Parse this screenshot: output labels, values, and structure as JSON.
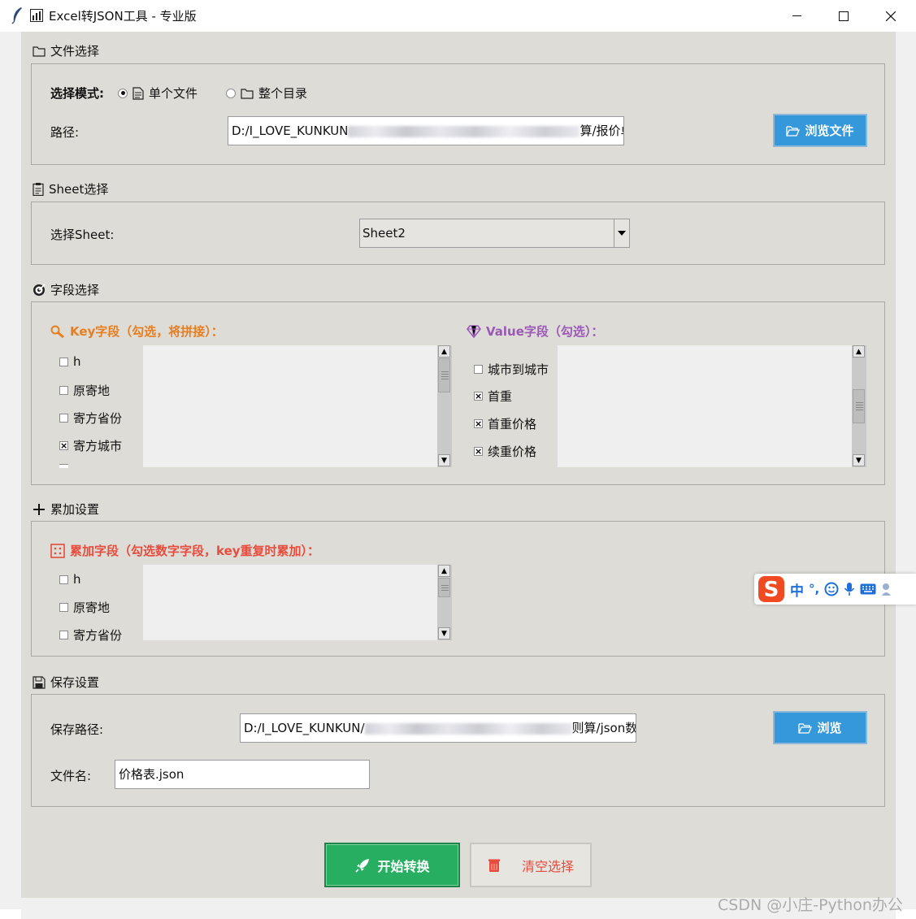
{
  "window": {
    "title": "Excel转JSON工具 - 专业版",
    "controls": {
      "minimize": "—",
      "maximize": "☐",
      "close": "✕"
    }
  },
  "file_section": {
    "title": "文件选择",
    "mode_label": "选择模式:",
    "mode_options": [
      {
        "label": "单个文件",
        "selected": true
      },
      {
        "label": "整个目录",
        "selected": false
      }
    ],
    "path_label": "路径:",
    "path_prefix": "D:/I_LOVE_KUNKUN",
    "path_suffix": "算/报价单",
    "browse_label": "浏览文件"
  },
  "sheet_section": {
    "title": "Sheet选择",
    "label": "选择Sheet:",
    "selected": "Sheet2"
  },
  "field_section": {
    "title": "字段选择",
    "key_title": "Key字段（勾选，将拼接）：",
    "value_title": "Value字段（勾选）：",
    "key_fields": [
      {
        "label": "h",
        "checked": false
      },
      {
        "label": "原寄地",
        "checked": false
      },
      {
        "label": "寄方省份",
        "checked": false
      },
      {
        "label": "寄方城市",
        "checked": true
      }
    ],
    "value_fields": [
      {
        "label": "城市到城市",
        "checked": false
      },
      {
        "label": "首重",
        "checked": true
      },
      {
        "label": "首重价格",
        "checked": true
      },
      {
        "label": "续重价格",
        "checked": true
      }
    ]
  },
  "accum_section": {
    "title": "累加设置",
    "subtitle": "累加字段（勾选数字字段，key重复时累加）：",
    "fields": [
      {
        "label": "h",
        "checked": false
      },
      {
        "label": "原寄地",
        "checked": false
      },
      {
        "label": "寄方省份",
        "checked": false
      }
    ]
  },
  "ime_toolbar": {
    "lang": "中",
    "punct": "°,"
  },
  "save_section": {
    "title": "保存设置",
    "path_label": "保存路径:",
    "path_prefix": "D:/I_LOVE_KUNKUN/",
    "path_suffix": "则算/json数",
    "browse_label": "浏览",
    "filename_label": "文件名:",
    "filename_value": "价格表.json"
  },
  "actions": {
    "convert_label": "开始转换",
    "clear_label": "清空选择"
  },
  "watermark": "CSDN @小庄-Python办公",
  "colors": {
    "window_bg": "#dddcd7",
    "accent_blue": "#3498db",
    "accent_green": "#27ae60",
    "key_orange": "#e67e22",
    "value_purple": "#9b59b6",
    "accum_red": "#e74c3c"
  }
}
